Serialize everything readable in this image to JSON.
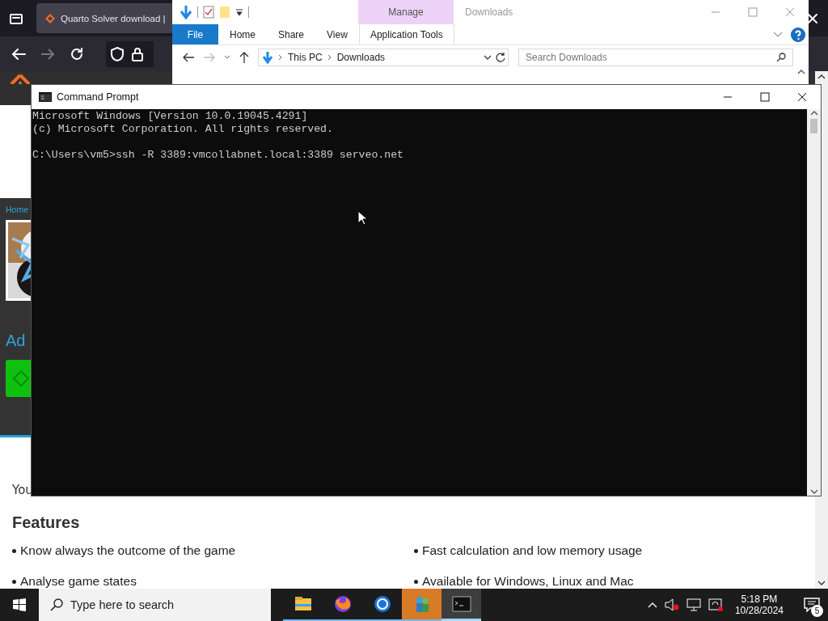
{
  "browser": {
    "tab_title": "Quarto Solver download |",
    "page": {
      "breadcrumb": "Home",
      "heading": "Ad",
      "paragraph": "You",
      "features_title": "Features",
      "features": [
        "Know always the outcome of the game",
        "Fast calculation and low memory usage",
        "Analyse game states",
        "Available for Windows, Linux and Mac"
      ]
    }
  },
  "explorer": {
    "contextual_tab": "Manage",
    "title": "Downloads",
    "ribbon_tabs": [
      {
        "label": "File",
        "selected": true
      },
      {
        "label": "Home",
        "selected": false
      },
      {
        "label": "Share",
        "selected": false
      },
      {
        "label": "View",
        "selected": false
      },
      {
        "label": "Application Tools",
        "selected": false
      }
    ],
    "path": [
      "This PC",
      "Downloads"
    ],
    "search": {
      "placeholder": "Search Downloads"
    }
  },
  "console": {
    "title": "Command Prompt",
    "output": [
      "Microsoft Windows [Version 10.0.19045.4291]",
      "(c) Microsoft Corporation. All rights reserved."
    ],
    "prompt": "C:\\Users\\vm5>",
    "command": "ssh -R 3389:vmcollabnet.local:3389 serveo.net"
  },
  "taskbar": {
    "search": {
      "placeholder": "Type here to search"
    },
    "apps": [
      {
        "kind": "folder",
        "selected": false,
        "flashing": false
      },
      {
        "kind": "firefox",
        "selected": false,
        "flashing": false
      },
      {
        "kind": "chrome",
        "selected": false,
        "flashing": false
      },
      {
        "kind": "people",
        "selected": false,
        "flashing": true
      },
      {
        "kind": "console",
        "selected": true,
        "flashing": false
      }
    ],
    "time": "5:18 PM",
    "date": "10/28/2024",
    "notification_count": "5"
  }
}
